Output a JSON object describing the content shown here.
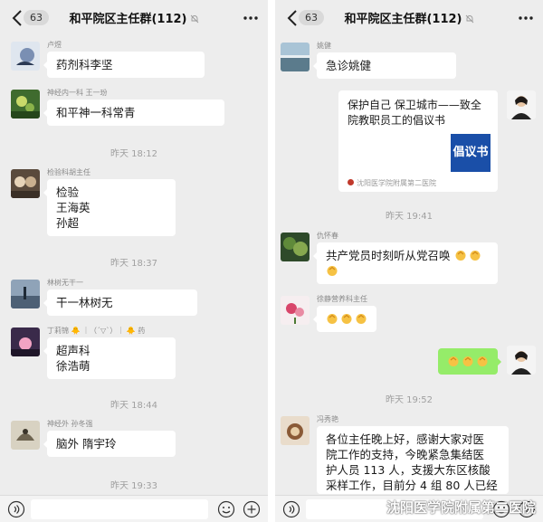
{
  "left": {
    "nav": {
      "badge": "63",
      "title": "和平院区主任群(112)"
    },
    "messages": [
      {
        "sender": "卢煜",
        "lines": [
          "药剂科李坚"
        ]
      },
      {
        "sender": "神经内一科 王一玢",
        "lines": [
          "和平神一科常青"
        ]
      },
      {
        "sender": "检验科胡主任",
        "lines": [
          "检验",
          "王海英",
          "孙超"
        ]
      },
      {
        "sender": "林树无干一",
        "lines": [
          "干一林树无"
        ]
      },
      {
        "sender": "丁莉锦 🐥 ｜（ˊ▽ˋ）｜ 🐥 药",
        "lines": [
          "超声科",
          "徐浩萌"
        ]
      },
      {
        "sender": "神经外 孙冬强",
        "lines": [
          "脑外 隋宇玲"
        ]
      }
    ],
    "times": [
      "昨天 18:12",
      "昨天 18:37",
      "昨天 18:44",
      "昨天 19:33"
    ]
  },
  "right": {
    "nav": {
      "badge": "63",
      "title": "和平院区主任群(112)"
    },
    "messages": [
      {
        "sender": "姚健",
        "lines": [
          "急诊姚健"
        ]
      },
      {
        "card": {
          "title": "保护自己 保卫城市——致全院教职员工的倡议书",
          "thumb": "倡议书",
          "source": "沈阳医学院附属第二医院"
        }
      },
      {
        "sender": "仇怀春",
        "lines": [
          "共产党员时刻听从党召唤"
        ]
      },
      {
        "sender": "徐静营养科主任"
      },
      {
        "sender": "冯秀艳",
        "lines": [
          "各位主任晚上好，感谢大家对医",
          "院工作的支持，今晚紧急集结医",
          "护人员 113 人，支援大东区核酸",
          "采样工作，目前分 4 组 80 人已经"
        ]
      }
    ],
    "times": [
      "昨天 19:41",
      "昨天 19:52"
    ]
  },
  "watermark": "沈阳医学院附属第二医院",
  "colors": {
    "background": "#ededed",
    "bubble": "#ffffff",
    "self_bubble": "#95ec69"
  },
  "icons": [
    "back-arrow-icon",
    "mute-bell-icon",
    "more-dots-icon",
    "voice-icon",
    "emoji-face-icon",
    "plus-icon",
    "hands-emoji-icon"
  ]
}
